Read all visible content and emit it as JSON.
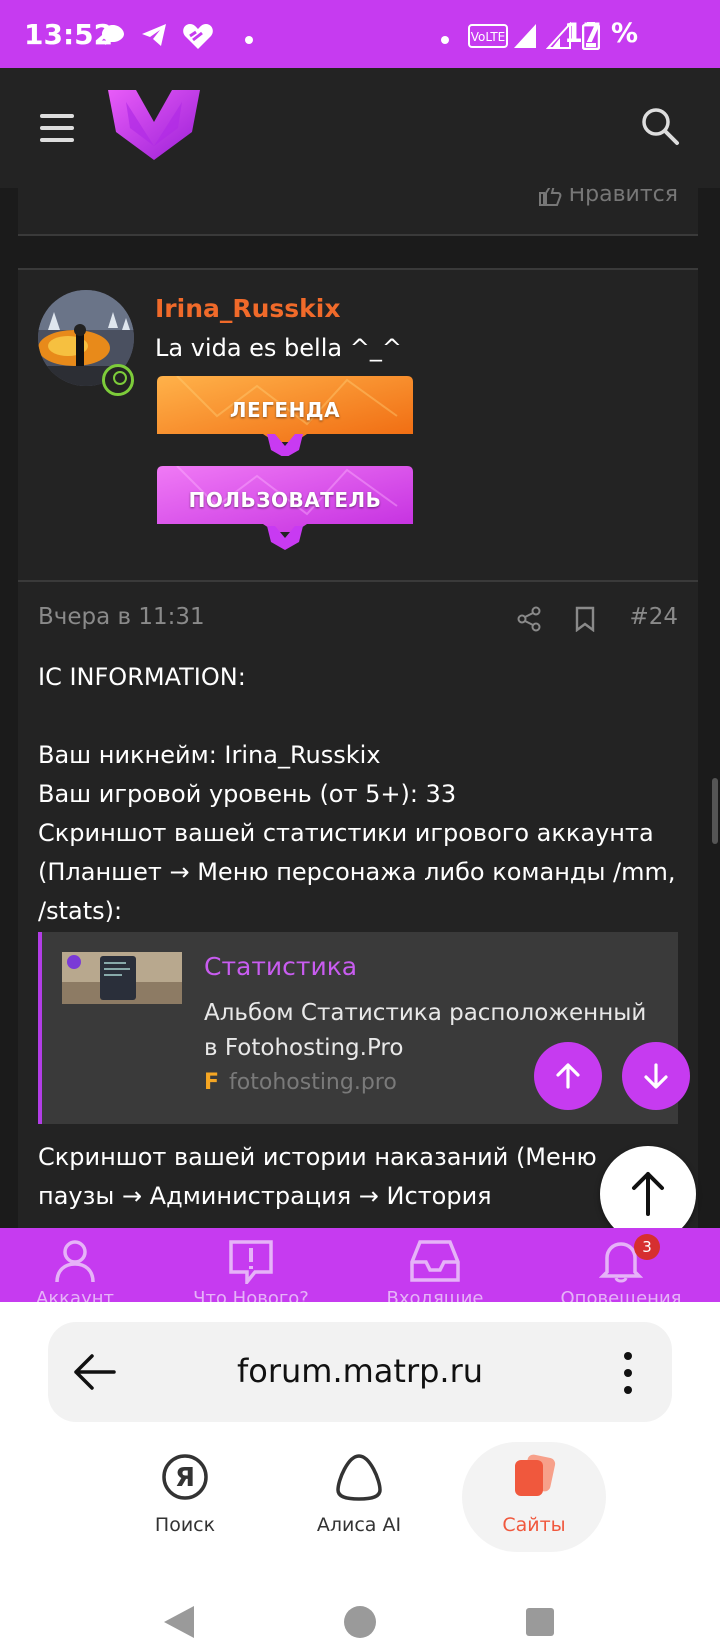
{
  "status_bar": {
    "time": "13:52",
    "battery": "17 %",
    "volte": "VoLTE"
  },
  "header": {
    "logo": "M",
    "menu_icon": "hamburger-icon",
    "search_icon": "search-icon"
  },
  "previous_post": {
    "like_label": "Нравится"
  },
  "post": {
    "author": {
      "name": "Irina_Russkix",
      "title": "La vida es bella ^_^",
      "badges": [
        "ЛЕГЕНДА",
        "ПОЛЬЗОВАТЕЛЬ"
      ],
      "online": true
    },
    "date": "Вчера в 11:31",
    "number": "#24",
    "body_lines": [
      "IC INFORMATION:",
      "",
      "Ваш никнейм: Irina_Russkix",
      "Ваш игровой уровень (от 5+): 33",
      "Скриншот вашей статистики игрового аккаунта (Планшет → Меню персонажа либо команды /mm, /stats):"
    ],
    "embed": {
      "title": "Статистика",
      "description": "Альбом Статистика расположенный в Fotohosting.Pro",
      "site": "fotohosting.pro",
      "site_letter": "F"
    },
    "body_lines_2": "Скриншот вашей истории наказаний (Меню паузы → Администрация → История"
  },
  "forum_nav": {
    "items": [
      {
        "label": "Аккаунт",
        "icon": "user-icon"
      },
      {
        "label": "Что Нового?",
        "icon": "whats-new-icon"
      },
      {
        "label": "Входящие",
        "icon": "inbox-icon"
      },
      {
        "label": "Оповещения",
        "icon": "bell-icon"
      }
    ],
    "alerts_count": "3"
  },
  "browser": {
    "url": "forum.matrp.ru",
    "tabs": [
      {
        "label": "Поиск",
        "icon": "yandex-search-icon"
      },
      {
        "label": "Алиса AI",
        "icon": "alice-icon"
      },
      {
        "label": "Сайты",
        "icon": "sites-icon"
      }
    ]
  },
  "colors": {
    "accent": "#c63bf0",
    "username": "#f06a2a",
    "link": "#c85cf0",
    "background": "#1b1b1b"
  }
}
